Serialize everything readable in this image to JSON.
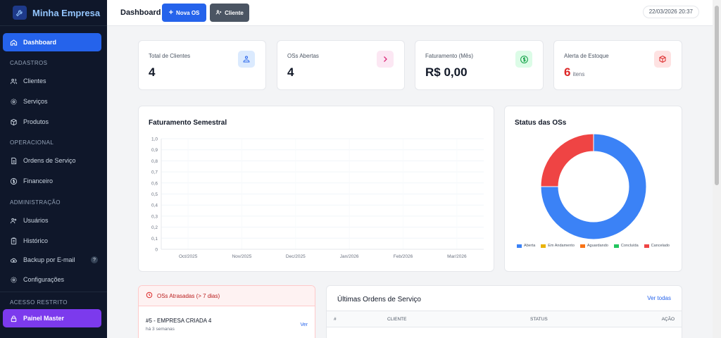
{
  "brand": {
    "name": "Minha Empresa",
    "icon": "wrench-icon"
  },
  "sidebar": {
    "dashboard": "Dashboard",
    "sections": {
      "cadastros": "CADASTROS",
      "operacional": "OPERACIONAL",
      "administracao": "ADMINISTRAÇÃO",
      "acesso": "ACESSO RESTRITO"
    },
    "items": {
      "clientes": "Clientes",
      "servicos": "Serviços",
      "produtos": "Produtos",
      "ordens": "Ordens de Serviço",
      "financeiro": "Financeiro",
      "usuarios": "Usuários",
      "historico": "Histórico",
      "backup": "Backup por E-mail",
      "configuracoes": "Configurações",
      "master": "Painel Master"
    },
    "help_badge": "?"
  },
  "header": {
    "title": "Dashboard",
    "new_os": "Nova OS",
    "client": "Cliente",
    "datetime": "22/03/2026 20:37"
  },
  "stats": {
    "clients": {
      "label": "Total de Clientes",
      "value": "4"
    },
    "open_os": {
      "label": "OSs Abertas",
      "value": "4"
    },
    "revenue": {
      "label": "Faturamento (Mês)",
      "value": "R$ 0,00"
    },
    "stock": {
      "label": "Alerta de Estoque",
      "value": "6",
      "unit": "itens"
    }
  },
  "colors": {
    "accent": "#2563eb",
    "master": "#7c3aed",
    "danger": "#dc2626",
    "aberta": "#3b82f6",
    "em_andamento": "#eab308",
    "aguardando": "#f97316",
    "concluida": "#22c55e",
    "cancelada": "#ef4444"
  },
  "revenue_chart": {
    "title": "Faturamento Semestral",
    "ticks_y": [
      "1,0",
      "0,9",
      "0,8",
      "0,7",
      "0,6",
      "0,5",
      "0,4",
      "0,3",
      "0,2",
      "0,1",
      "0"
    ],
    "chart_data": {
      "type": "line",
      "categories": [
        "Oct/2025",
        "Nov/2025",
        "Dec/2025",
        "Jan/2026",
        "Feb/2026",
        "Mar/2026"
      ],
      "values": [],
      "ylim": [
        0,
        1
      ],
      "grid": true
    }
  },
  "status_chart": {
    "title": "Status das OSs",
    "chart_data": {
      "type": "pie",
      "categories": [
        "Aberta",
        "Em Andamento",
        "Aguardando",
        "Concluída",
        "Cancelado"
      ],
      "values": [
        3,
        0,
        0,
        0,
        1
      ]
    }
  },
  "overdue": {
    "title": "OSs Atrasadas (> 7 dias)",
    "item_title": "#5 - EMPRESA CRIADA 4",
    "item_sub": "há 3 semanas",
    "link": "Ver"
  },
  "recent": {
    "title": "Últimas Ordens de Serviço",
    "link": "Ver todas",
    "columns": [
      "#",
      "CLIENTE",
      "STATUS",
      "AÇÃO"
    ]
  }
}
